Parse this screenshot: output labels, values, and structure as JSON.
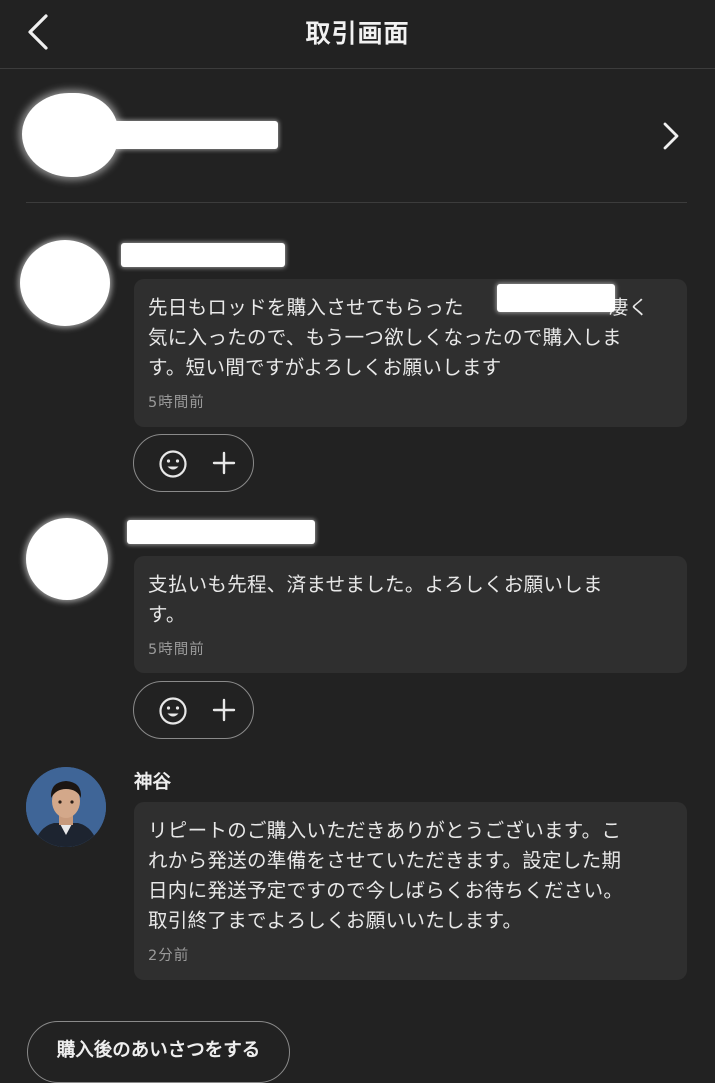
{
  "header": {
    "title": "取引画面",
    "back_icon": "chevron-left-icon"
  },
  "user_row": {
    "name": "",
    "chevron_icon": "chevron-right-icon"
  },
  "messages": [
    {
      "author": "",
      "text": "先日もロッドを購入させてもらった　　　　　　　 凄く\n気に入ったので、もう一つ欲しくなったので購入しま\nす。短い間ですがよろしくお願いします",
      "time": "5時間前",
      "reaction_icons": [
        "smile-icon",
        "plus-icon"
      ]
    },
    {
      "author": "",
      "text": "支払いも先程、済ませました。よろしくお願いしま\nす。",
      "time": "5時間前",
      "reaction_icons": [
        "smile-icon",
        "plus-icon"
      ]
    },
    {
      "author": "神谷",
      "text": "リピートのご購入いただきありがとうございます。こ\nれから発送の準備をさせていただきます。設定した期\n日内に発送予定ですので今しばらくお待ちください。\n取引終了までよろしくお願いいたします。",
      "time": "2分前"
    }
  ],
  "footer": {
    "greeting_button": "購入後のあいさつをする"
  },
  "colors": {
    "background": "#222222",
    "bubble": "#2f2f2f",
    "text": "#e8e8e8",
    "muted": "#9a9a9a",
    "border": "#8a8a8a"
  }
}
